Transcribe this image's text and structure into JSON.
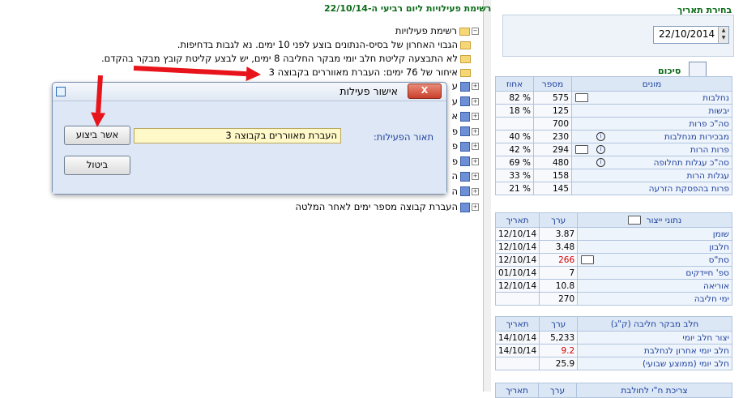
{
  "date_section": {
    "title": "בחירת תאריך",
    "date_value": "22/10/2014"
  },
  "summary_section": {
    "title": "סיכום"
  },
  "cows_table": {
    "headers": [
      "מונים",
      "מספר",
      "אחוז"
    ],
    "rows": [
      {
        "name": "נחלבות",
        "count": "575",
        "pct": "82 %",
        "folder": true,
        "info": false
      },
      {
        "name": "יבשות",
        "count": "125",
        "pct": "18 %",
        "folder": false,
        "info": false
      },
      {
        "name": "סה\"כ פרות",
        "count": "700",
        "pct": "",
        "folder": false,
        "info": false
      },
      {
        "name": "מבכירות מנחלבות",
        "count": "230",
        "pct": "40 %",
        "folder": false,
        "info": true
      },
      {
        "name": "פרות הרות",
        "count": "294",
        "pct": "42 %",
        "folder": true,
        "info": true
      },
      {
        "name": "סה\"כ עגלות תחלופה",
        "count": "480",
        "pct": "69 %",
        "folder": false,
        "info": true
      },
      {
        "name": "עגלות הרות",
        "count": "158",
        "pct": "33 %",
        "folder": false,
        "info": false
      },
      {
        "name": "פרות בהפסקת הזרעה",
        "count": "145",
        "pct": "21 %",
        "folder": false,
        "info": false
      }
    ]
  },
  "production_table": {
    "headers": [
      "נתוני ייצור",
      "ערך",
      "תאריך"
    ],
    "rows": [
      {
        "name": "שומן",
        "value": "3.87",
        "date": "12/10/14",
        "red": false,
        "folder": false
      },
      {
        "name": "חלבון",
        "value": "3.48",
        "date": "12/10/14",
        "red": false,
        "folder": false
      },
      {
        "name": "סת\"ס",
        "value": "266",
        "date": "12/10/14",
        "red": true,
        "folder": true
      },
      {
        "name": "ספ' חיידקים",
        "value": "7",
        "date": "01/10/14",
        "red": false,
        "folder": false
      },
      {
        "name": "אוריאה",
        "value": "10.8",
        "date": "12/10/14",
        "red": false,
        "folder": false
      },
      {
        "name": "ימי חליבה",
        "value": "270",
        "date": "",
        "red": false,
        "folder": false
      }
    ]
  },
  "milk_table": {
    "headers": [
      "חלב מבקר חליבה (ק\"ג)",
      "ערך",
      "תאריך"
    ],
    "rows": [
      {
        "name": "יצור חלב  יומי",
        "value": "5,233",
        "date": "14/10/14",
        "red": false
      },
      {
        "name": "חלב יומי אחרון לנחלבת",
        "value": "9.2",
        "date": "14/10/14",
        "red": true
      },
      {
        "name": "חלב יומי (ממוצע שבועי)",
        "value": "25.9",
        "date": "",
        "red": false
      }
    ]
  },
  "feed_table": {
    "headers": [
      "צריכת ח\"י לחולבת",
      "ערך",
      "תאריך"
    ]
  },
  "tree": {
    "title": "רשימת פעילויות ליום רביעי ה-22/10/14",
    "root": "רשימת פעילויות",
    "items": [
      "הגבוי האחרון של בסיס-הנתונים בוצע לפני 10 ימים. נא לגבות בדחיפות.",
      "לא התבצעה קליטת חלב יומי מבקר החליבה 8 ימים, יש לבצע קליטת קובץ מבקר בהקדם.",
      "איחור של 76 ימים: העברת מאווררים בקבוצה 3"
    ],
    "partial_letters": [
      "ע",
      "ע",
      "א",
      "פ",
      "פ",
      "פ",
      "ה",
      "ה"
    ],
    "last_item": "העברת קבוצה מספר ימים לאחר המלטה"
  },
  "dialog": {
    "title": "אישור פעילות",
    "close": "X",
    "confirm_label": "אשר ביצוע",
    "cancel_label": "ביטול",
    "desc_label": "תאור הפעילות:",
    "desc_value": "העברת מאווררים בקבוצה 3"
  },
  "colors": {
    "annotation_arrow": "#e8141b",
    "header_text": "#1d3f9e",
    "section_title": "#0d6b1a"
  }
}
